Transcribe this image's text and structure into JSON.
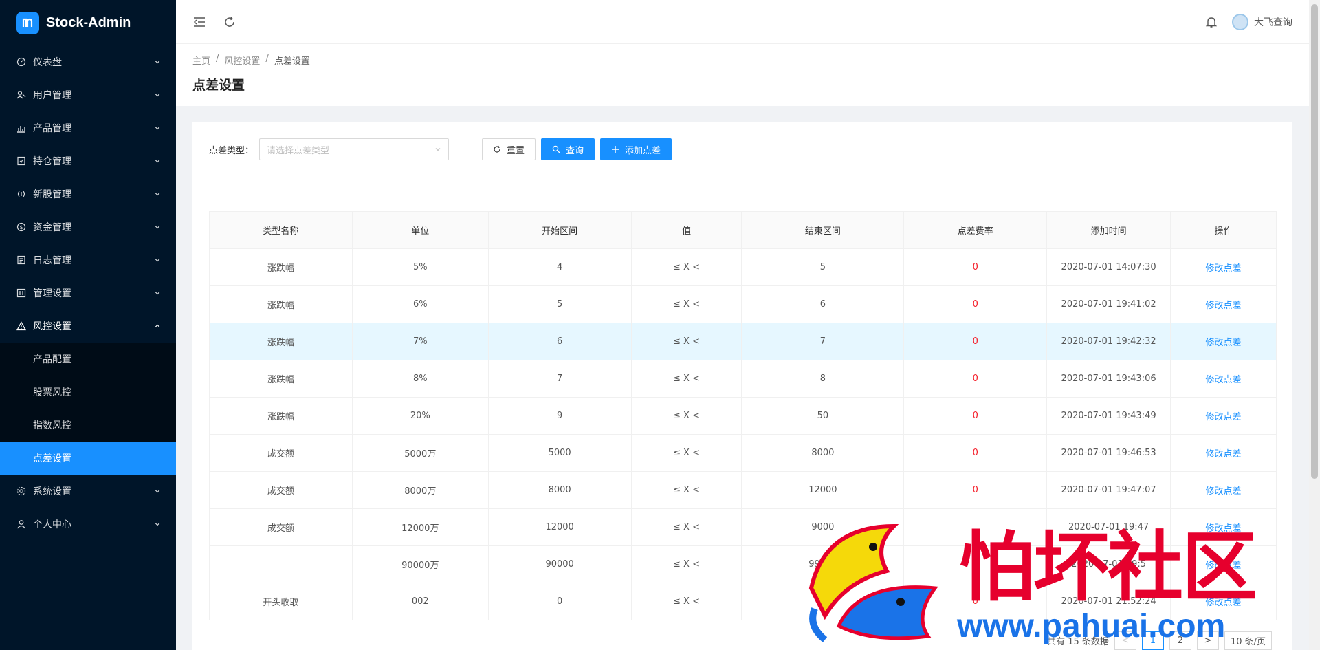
{
  "app": {
    "title": "Stock-Admin"
  },
  "sidebar": {
    "items": [
      {
        "label": "仪表盘",
        "icon": "dashboard-icon"
      },
      {
        "label": "用户管理",
        "icon": "user-group-icon"
      },
      {
        "label": "产品管理",
        "icon": "chart-icon"
      },
      {
        "label": "持仓管理",
        "icon": "position-icon"
      },
      {
        "label": "新股管理",
        "icon": "signal-icon"
      },
      {
        "label": "资金管理",
        "icon": "money-icon"
      },
      {
        "label": "日志管理",
        "icon": "log-icon"
      },
      {
        "label": "管理设置",
        "icon": "settings-panel-icon"
      },
      {
        "label": "风控设置",
        "icon": "warning-icon",
        "open": true
      },
      {
        "label": "系统设置",
        "icon": "gear-icon"
      },
      {
        "label": "个人中心",
        "icon": "person-icon"
      }
    ],
    "submenu": [
      {
        "label": "产品配置"
      },
      {
        "label": "股票风控"
      },
      {
        "label": "指数风控"
      },
      {
        "label": "点差设置",
        "active": true
      }
    ]
  },
  "header": {
    "username": "大飞查询"
  },
  "breadcrumb": {
    "home": "主页",
    "parent": "风控设置",
    "current": "点差设置"
  },
  "page": {
    "title": "点差设置"
  },
  "filter": {
    "label": "点差类型：",
    "placeholder": "请选择点差类型",
    "reset_label": "重置",
    "search_label": "查询",
    "add_label": "添加点差"
  },
  "table": {
    "columns": [
      "类型名称",
      "单位",
      "开始区间",
      "值",
      "结束区间",
      "点差费率",
      "添加时间",
      "操作"
    ],
    "rows": [
      [
        "涨跌幅",
        "5%",
        "4",
        "≤ X <",
        "5",
        "0",
        "2020-07-01 14:07:30",
        "修改点差"
      ],
      [
        "涨跌幅",
        "6%",
        "5",
        "≤ X <",
        "6",
        "0",
        "2020-07-01 19:41:02",
        "修改点差"
      ],
      [
        "涨跌幅",
        "7%",
        "6",
        "≤ X <",
        "7",
        "0",
        "2020-07-01 19:42:32",
        "修改点差"
      ],
      [
        "涨跌幅",
        "8%",
        "7",
        "≤ X <",
        "8",
        "0",
        "2020-07-01 19:43:06",
        "修改点差"
      ],
      [
        "涨跌幅",
        "20%",
        "9",
        "≤ X <",
        "50",
        "0",
        "2020-07-01 19:43:49",
        "修改点差"
      ],
      [
        "成交额",
        "5000万",
        "5000",
        "≤ X <",
        "8000",
        "0",
        "2020-07-01 19:46:53",
        "修改点差"
      ],
      [
        "成交额",
        "8000万",
        "8000",
        "≤ X <",
        "12000",
        "0",
        "2020-07-01 19:47:07",
        "修改点差"
      ],
      [
        "成交额",
        "12000万",
        "12000",
        "≤ X <",
        "9000",
        "",
        "2020-07-01 19:47",
        "修改点差"
      ],
      [
        "",
        "90000万",
        "90000",
        "≤ X <",
        "99999",
        "",
        "2020-07-01 19:5",
        "修改点差"
      ],
      [
        "开头收取",
        "002",
        "0",
        "≤ X <",
        "",
        "0",
        "2020-07-01 21:52:24",
        "修改点差"
      ]
    ],
    "highlight_row": 2
  },
  "pagination": {
    "total_text": "共有 15 条数据",
    "prev": "<",
    "pages": [
      "1",
      "2"
    ],
    "current": "1",
    "next": ">",
    "page_size": "10 条/页"
  },
  "watermark": {
    "text": "怕坏社区",
    "url": "www.pahuai.com"
  },
  "colors": {
    "primary": "#1890ff",
    "sidebar_bg": "#001529",
    "rate": "#f5222d",
    "watermark_red": "#e6002d",
    "watermark_blue": "#1a73e8"
  }
}
